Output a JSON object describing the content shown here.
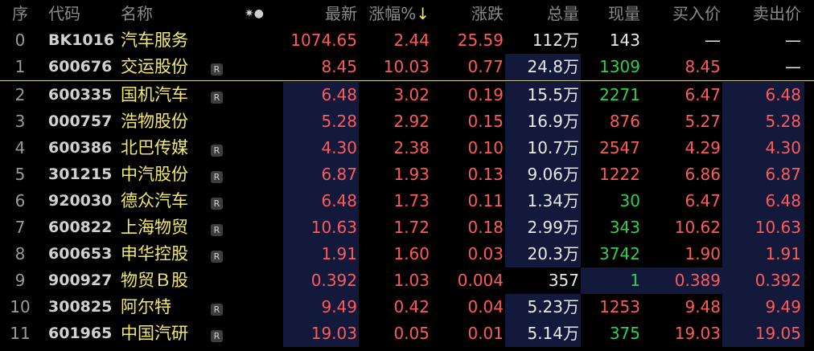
{
  "columns": {
    "idx": "序",
    "code": "代码",
    "name": "名称",
    "settings_icon": "gear-dot-icon",
    "last": "最新",
    "pct": "涨幅%",
    "pct_arrow": "↓",
    "chg": "涨跌",
    "vol": "总量",
    "now": "现量",
    "bid": "买入价",
    "ask": "卖出价"
  },
  "colors": {
    "up": "#ff5a5a",
    "down": "#2fd04a",
    "name": "#f2e96a",
    "divider": "#d9d07a",
    "shade": "#12193a"
  },
  "rows": [
    {
      "idx": "0",
      "code": "BK1016",
      "name": "汽车服务",
      "r": false,
      "last": "1074.65",
      "pct": "2.44",
      "chg": "25.59",
      "vol": "112万",
      "now": "143",
      "now_dir": "flat",
      "bid": "—",
      "ask": "—",
      "bid_dir": "flat",
      "ask_dir": "flat"
    },
    {
      "idx": "1",
      "code": "600676",
      "name": "交运股份",
      "r": true,
      "last": "8.45",
      "pct": "10.03",
      "chg": "0.77",
      "vol": "24.8万",
      "now": "1309",
      "now_dir": "down",
      "bid": "8.45",
      "ask": "—",
      "bid_dir": "up",
      "ask_dir": "flat"
    },
    {
      "idx": "2",
      "code": "600335",
      "name": "国机汽车",
      "r": true,
      "last": "6.48",
      "pct": "3.02",
      "chg": "0.19",
      "vol": "15.5万",
      "now": "2271",
      "now_dir": "down",
      "bid": "6.47",
      "ask": "6.48",
      "bid_dir": "up",
      "ask_dir": "up"
    },
    {
      "idx": "3",
      "code": "000757",
      "name": "浩物股份",
      "r": false,
      "last": "5.28",
      "pct": "2.92",
      "chg": "0.15",
      "vol": "16.9万",
      "now": "876",
      "now_dir": "up",
      "bid": "5.27",
      "ask": "5.28",
      "bid_dir": "up",
      "ask_dir": "up"
    },
    {
      "idx": "4",
      "code": "600386",
      "name": "北巴传媒",
      "r": true,
      "last": "4.30",
      "pct": "2.38",
      "chg": "0.10",
      "vol": "10.7万",
      "now": "2547",
      "now_dir": "up",
      "bid": "4.29",
      "ask": "4.30",
      "bid_dir": "up",
      "ask_dir": "up"
    },
    {
      "idx": "5",
      "code": "301215",
      "name": "中汽股份",
      "r": true,
      "last": "6.87",
      "pct": "1.93",
      "chg": "0.13",
      "vol": "9.06万",
      "now": "1222",
      "now_dir": "up",
      "bid": "6.86",
      "ask": "6.87",
      "bid_dir": "up",
      "ask_dir": "up"
    },
    {
      "idx": "6",
      "code": "920030",
      "name": "德众汽车",
      "r": true,
      "last": "6.48",
      "pct": "1.73",
      "chg": "0.11",
      "vol": "1.34万",
      "now": "30",
      "now_dir": "down",
      "bid": "6.47",
      "ask": "6.48",
      "bid_dir": "up",
      "ask_dir": "up"
    },
    {
      "idx": "7",
      "code": "600822",
      "name": "上海物贸",
      "r": true,
      "last": "10.63",
      "pct": "1.72",
      "chg": "0.18",
      "vol": "2.99万",
      "now": "343",
      "now_dir": "down",
      "bid": "10.62",
      "ask": "10.63",
      "bid_dir": "up",
      "ask_dir": "up"
    },
    {
      "idx": "8",
      "code": "600653",
      "name": "申华控股",
      "r": true,
      "last": "1.91",
      "pct": "1.60",
      "chg": "0.03",
      "vol": "20.3万",
      "now": "3742",
      "now_dir": "down",
      "bid": "1.90",
      "ask": "1.91",
      "bid_dir": "up",
      "ask_dir": "up"
    },
    {
      "idx": "9",
      "code": "900927",
      "name": "物贸Ｂ股",
      "r": false,
      "last": "0.392",
      "pct": "1.03",
      "chg": "0.004",
      "vol": "357",
      "now": "1",
      "now_dir": "down",
      "bid": "0.389",
      "ask": "0.392",
      "bid_dir": "up",
      "ask_dir": "up"
    },
    {
      "idx": "10",
      "code": "300825",
      "name": "阿尔特",
      "r": true,
      "last": "9.49",
      "pct": "0.42",
      "chg": "0.04",
      "vol": "5.23万",
      "now": "1253",
      "now_dir": "up",
      "bid": "9.48",
      "ask": "9.49",
      "bid_dir": "up",
      "ask_dir": "up"
    },
    {
      "idx": "11",
      "code": "601965",
      "name": "中国汽研",
      "r": true,
      "last": "19.03",
      "pct": "0.05",
      "chg": "0.01",
      "vol": "5.14万",
      "now": "375",
      "now_dir": "down",
      "bid": "19.03",
      "ask": "19.05",
      "bid_dir": "up",
      "ask_dir": "up"
    }
  ]
}
